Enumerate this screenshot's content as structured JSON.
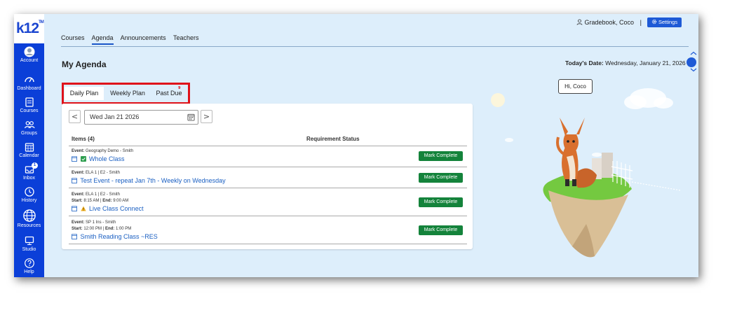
{
  "app": {
    "logo": "k12",
    "logo_tm": "TM"
  },
  "sidebar": {
    "items": [
      {
        "label": "Account",
        "icon": "account-icon"
      },
      {
        "label": "Dashboard",
        "icon": "dashboard-icon"
      },
      {
        "label": "Courses",
        "icon": "courses-icon"
      },
      {
        "label": "Groups",
        "icon": "groups-icon"
      },
      {
        "label": "Calendar",
        "icon": "calendar-icon"
      },
      {
        "label": "Inbox",
        "icon": "inbox-icon",
        "badge": "1"
      },
      {
        "label": "History",
        "icon": "history-icon"
      },
      {
        "label": "Resources",
        "icon": "globe-icon"
      },
      {
        "label": "Studio",
        "icon": "studio-icon"
      },
      {
        "label": "Help",
        "icon": "help-icon"
      }
    ]
  },
  "top_tabs": [
    "Courses",
    "Agenda",
    "Announcements",
    "Teachers"
  ],
  "header": {
    "user": "Gradebook, Coco",
    "separator": "|",
    "settings": "Settings"
  },
  "page": {
    "title": "My Agenda",
    "today_label": "Today's Date:",
    "today_value": "Wednesday, January 21, 2026"
  },
  "plan_tabs": {
    "daily": "Daily Plan",
    "weekly": "Weekly Plan",
    "past_due": "Past Due",
    "past_due_badge": "9"
  },
  "date_picker": {
    "value": "Wed Jan 21 2026",
    "prev": "<",
    "next": ">"
  },
  "table": {
    "items_header": "Items (4)",
    "status_header": "Requirement Status",
    "rows": [
      {
        "event_label": "Event:",
        "event": "Geography Demo - Smith",
        "time": "",
        "title": "Whole Class",
        "button": "Mark Complete"
      },
      {
        "event_label": "Event:",
        "event": "ELA 1 | E2 - Smith",
        "time": "",
        "title": "Test Event - repeat Jan 7th - Weekly on Wednesday",
        "button": "Mark Complete"
      },
      {
        "event_label": "Event:",
        "event": "ELA 1 | E2 - Smith",
        "start_label": "Start:",
        "start": "8:15 AM",
        "end_label": "End:",
        "end": "9:00 AM",
        "title": "Live Class Connect",
        "button": "Mark Complete"
      },
      {
        "event_label": "Event:",
        "event": "SP 1 Ins - Smith",
        "start_label": "Start:",
        "start": "12:00 PM",
        "end_label": "End:",
        "end": "1:00 PM",
        "title": "Smith Reading Class ~RES",
        "button": "Mark Complete"
      }
    ]
  },
  "mascot": {
    "greeting": "Hi, Coco"
  },
  "colors": {
    "nav": "#0b3fd8",
    "accent": "#1e5ad6",
    "success": "#14833b",
    "highlight": "#e0121a",
    "background": "#ddeefb"
  }
}
